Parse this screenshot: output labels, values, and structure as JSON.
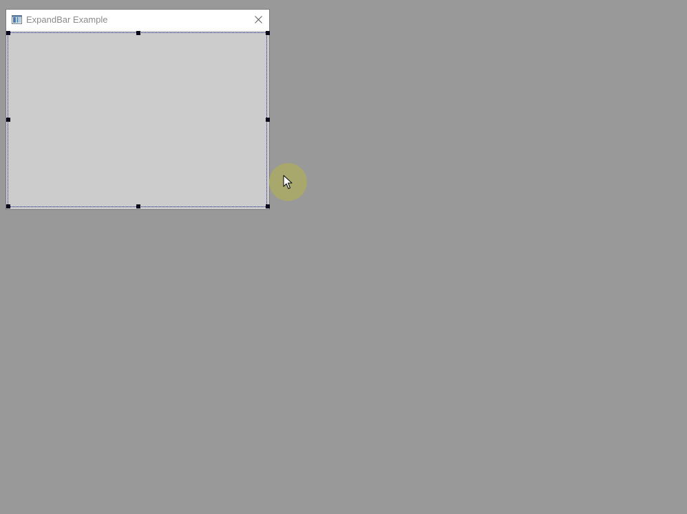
{
  "window": {
    "title": "ExpandBar Example",
    "icons": {
      "app": "window-app-icon",
      "close": "close-icon"
    }
  },
  "canvas": {
    "selection_state": "selected",
    "handles": [
      "top-left",
      "top-center",
      "top-right",
      "middle-left",
      "middle-right",
      "bottom-left",
      "bottom-center",
      "bottom-right"
    ]
  },
  "cursor": {
    "icon": "mouse-pointer-icon"
  },
  "colors": {
    "desktop": "#999999",
    "client_area": "#cccccc",
    "titlebar": "#ffffff",
    "selection_border": "#1a1a8a",
    "cursor_highlight": "#aaaa64"
  }
}
